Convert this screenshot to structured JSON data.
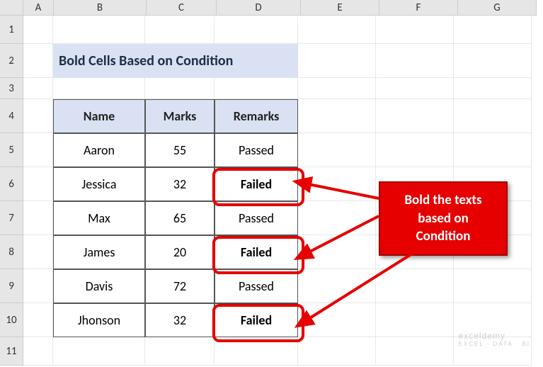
{
  "columns": [
    "",
    "A",
    "B",
    "C",
    "D",
    "E",
    "F",
    "G"
  ],
  "rows": [
    "1",
    "2",
    "3",
    "4",
    "5",
    "6",
    "7",
    "8",
    "9",
    "10",
    "11"
  ],
  "title": "Bold Cells Based on Condition",
  "table": {
    "headers": [
      "Name",
      "Marks",
      "Remarks"
    ],
    "data": [
      {
        "name": "Aaron",
        "marks": "55",
        "remarks": "Passed",
        "bold": false
      },
      {
        "name": "Jessica",
        "marks": "32",
        "remarks": "Failed",
        "bold": true
      },
      {
        "name": "Max",
        "marks": "65",
        "remarks": "Passed",
        "bold": false
      },
      {
        "name": "James",
        "marks": "20",
        "remarks": "Failed",
        "bold": true
      },
      {
        "name": "Davis",
        "marks": "72",
        "remarks": "Passed",
        "bold": false
      },
      {
        "name": "Jhonson",
        "marks": "32",
        "remarks": "Failed",
        "bold": true
      }
    ]
  },
  "callout": "Bold the texts\nbased on\nCondition",
  "watermark": {
    "main": "exceldemy",
    "sub": "EXCEL · DATA · BI"
  }
}
